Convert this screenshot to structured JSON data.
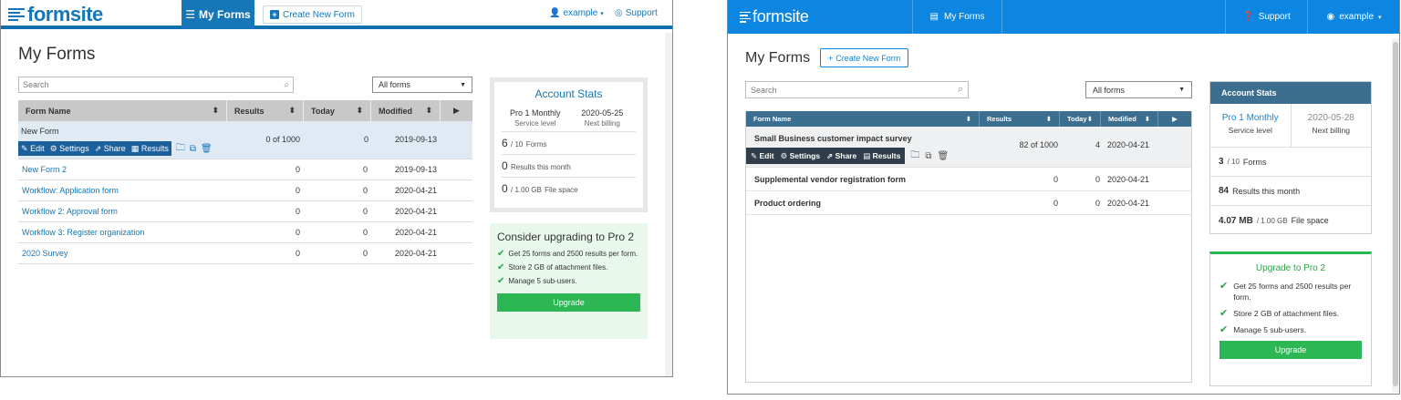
{
  "old_ui": {
    "brand": "formsite",
    "nav_active": "My Forms",
    "create_btn": "Create New Form",
    "user": "example",
    "support": "Support",
    "page_title": "My Forms",
    "search_placeholder": "Search",
    "filter_value": "All forms",
    "columns": [
      "Form Name",
      "Results",
      "Today",
      "Modified"
    ],
    "actions": [
      "Edit",
      "Settings",
      "Share",
      "Results"
    ],
    "rows": [
      {
        "name": "New Form",
        "results": "0 of 1000",
        "today": "0",
        "modified": "2019-09-13"
      },
      {
        "name": "New Form 2",
        "results": "0",
        "today": "0",
        "modified": "2019-09-13"
      },
      {
        "name": "Workflow: Application form",
        "results": "0",
        "today": "0",
        "modified": "2020-04-21"
      },
      {
        "name": "Workflow 2: Approval form",
        "results": "0",
        "today": "0",
        "modified": "2020-04-21"
      },
      {
        "name": "Workflow 3: Register organization",
        "results": "0",
        "today": "0",
        "modified": "2020-04-21"
      },
      {
        "name": "2020 Survey",
        "results": "0",
        "today": "0",
        "modified": "2020-04-21"
      }
    ],
    "stats": {
      "title": "Account Stats",
      "level": "Pro 1 Monthly",
      "level_caption": "Service level",
      "billing": "2020-05-25",
      "billing_caption": "Next billing",
      "forms_used": "6",
      "forms_total": "/ 10",
      "forms_caption": "Forms",
      "results_used": "0",
      "results_caption": "Results this month",
      "space_used": "0",
      "space_total": "/ 1.00 GB",
      "space_caption": "File space"
    },
    "upgrade": {
      "title": "Consider upgrading to Pro 2",
      "items": [
        "Get 25 forms and 2500 results per form.",
        "Store 2 GB of attachment files.",
        "Manage 5 sub-users."
      ],
      "button": "Upgrade"
    }
  },
  "new_ui": {
    "brand": "formsite",
    "nav_active": "My Forms",
    "support": "Support",
    "user": "example",
    "page_title": "My Forms",
    "create_btn": "Create New Form",
    "search_placeholder": "Search",
    "filter_value": "All forms",
    "columns": [
      "Form Name",
      "Results",
      "Today",
      "Modified"
    ],
    "actions": [
      "Edit",
      "Settings",
      "Share",
      "Results"
    ],
    "rows": [
      {
        "name": "Small Business customer impact survey",
        "results": "82 of 1000",
        "today": "4",
        "modified": "2020-04-21"
      },
      {
        "name": "Supplemental vendor registration form",
        "results": "0",
        "today": "0",
        "modified": "2020-04-21"
      },
      {
        "name": "Product ordering",
        "results": "0",
        "today": "0",
        "modified": "2020-04-21"
      }
    ],
    "stats": {
      "title": "Account Stats",
      "level": "Pro 1 Monthly",
      "level_caption": "Service level",
      "billing": "2020-05-28",
      "billing_caption": "Next billing",
      "forms_used": "3",
      "forms_total": "/ 10",
      "forms_caption": "Forms",
      "results_used": "84",
      "results_caption": "Results this month",
      "space_used": "4.07 MB",
      "space_total": "/ 1.00 GB",
      "space_caption": "File space"
    },
    "upgrade": {
      "title": "Upgrade to Pro 2",
      "items": [
        "Get 25 forms and 2500 results per form.",
        "Store 2 GB of attachment files.",
        "Manage 5 sub-users."
      ],
      "button": "Upgrade"
    }
  },
  "colors": {
    "old_accent": "#1577b8",
    "new_accent": "#0c86e0",
    "upgrade_green": "#2db654"
  }
}
